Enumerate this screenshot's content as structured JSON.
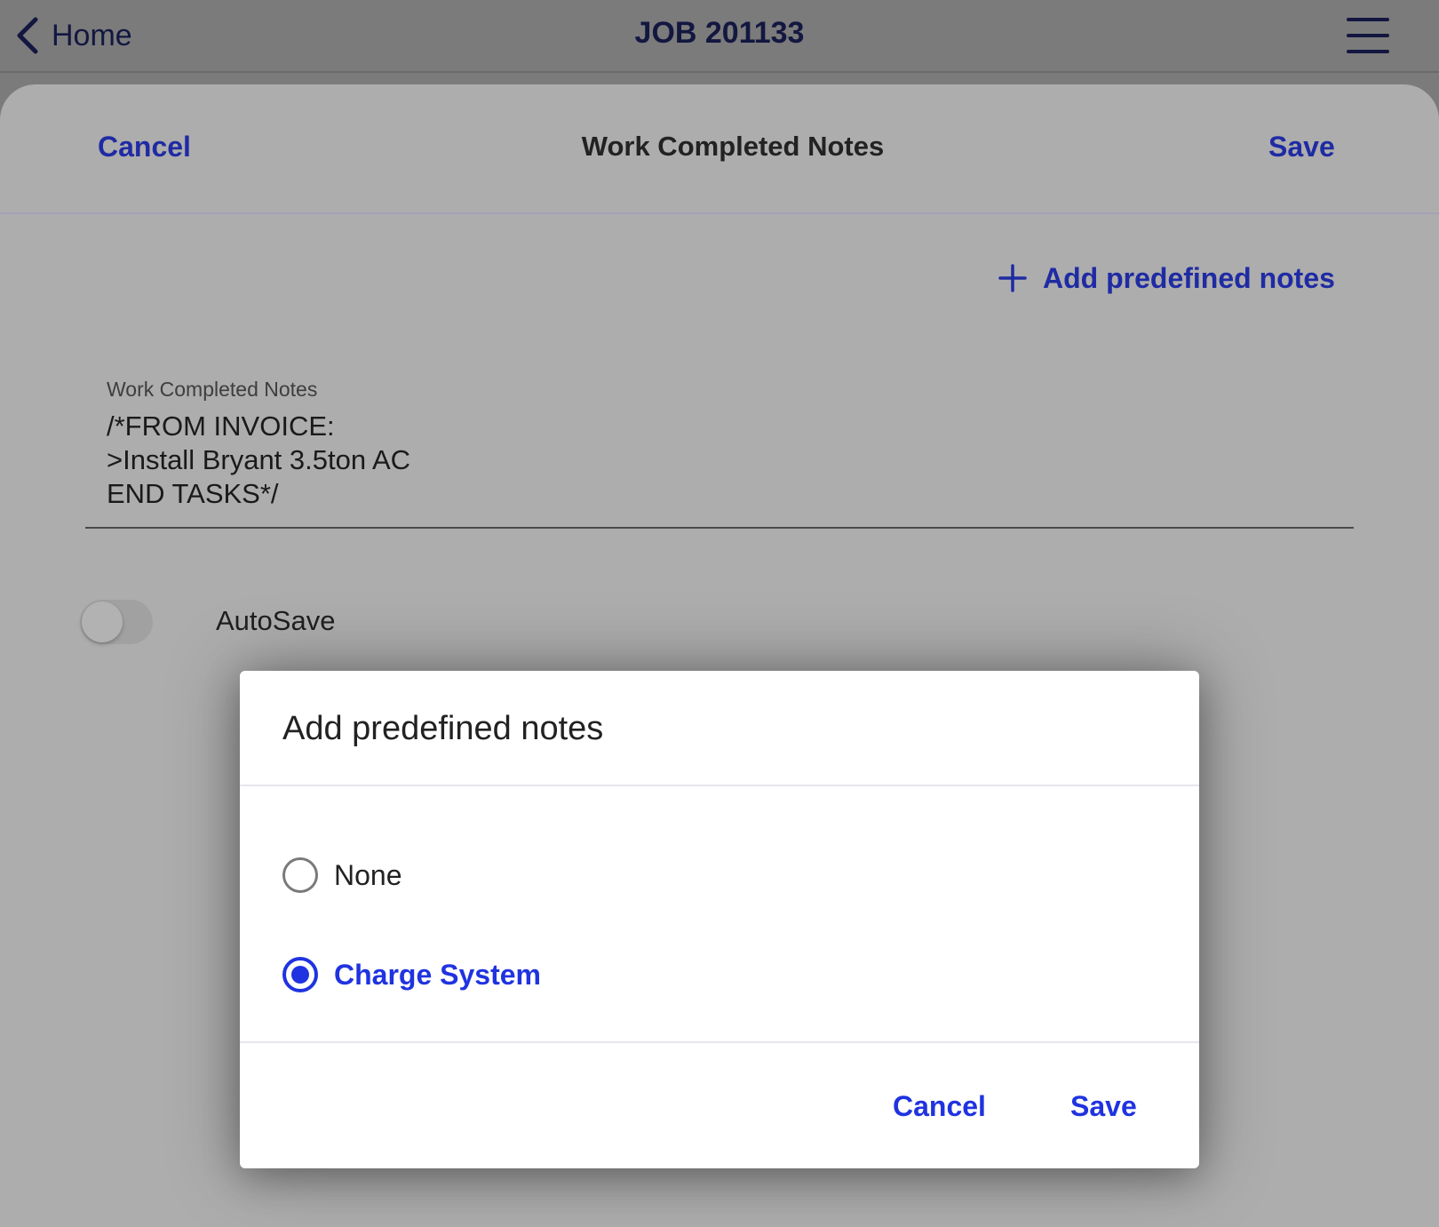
{
  "navbar": {
    "back_label": "Home",
    "title": "JOB 201133",
    "menu_icon": "hamburger-menu-icon"
  },
  "sheet": {
    "cancel_label": "Cancel",
    "title": "Work Completed Notes",
    "save_label": "Save",
    "add_predefined_label": "Add predefined notes",
    "notes_label": "Work Completed Notes",
    "notes_value": "/*FROM INVOICE:\n>Install Bryant 3.5ton AC\nEND TASKS*/",
    "autosave_label": "AutoSave",
    "autosave_on": false
  },
  "dialog": {
    "title": "Add predefined notes",
    "options": [
      {
        "label": "None",
        "selected": false
      },
      {
        "label": "Charge System",
        "selected": true
      }
    ],
    "cancel_label": "Cancel",
    "save_label": "Save"
  },
  "colors": {
    "accent": "#1f33e0",
    "link": "#1f2ba3",
    "overlay": "#adadad"
  }
}
